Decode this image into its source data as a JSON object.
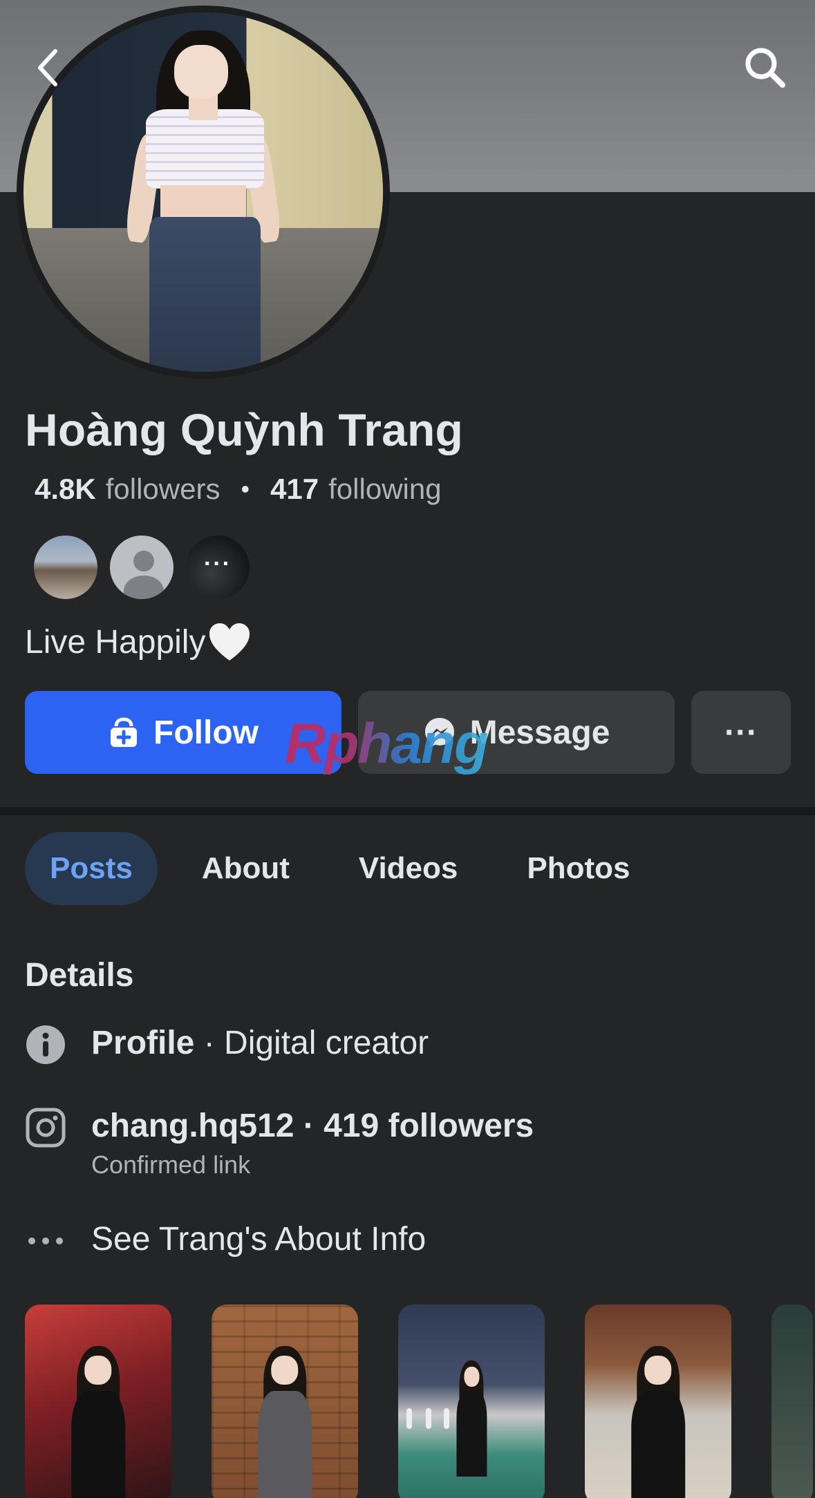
{
  "header": {
    "back_icon": "chevron-left-icon",
    "search_icon": "search-icon"
  },
  "profile": {
    "name": "Hoàng Quỳnh Trang",
    "followers_count": "4.8K",
    "followers_label": "followers",
    "separator": "•",
    "following_count": "417",
    "following_label": "following",
    "mutual_more": "···",
    "bio": "Live Happily",
    "bio_emoji": "white-heart-icon"
  },
  "actions": {
    "follow_label": "Follow",
    "message_label": "Message",
    "more_label": "···"
  },
  "watermark": "Rphang",
  "tabs": [
    {
      "label": "Posts",
      "active": true
    },
    {
      "label": "About",
      "active": false
    },
    {
      "label": "Videos",
      "active": false
    },
    {
      "label": "Photos",
      "active": false
    }
  ],
  "details": {
    "title": "Details",
    "profile_label": "Profile",
    "profile_value": " · Digital creator",
    "instagram_text": "chang.hq512 · 419 followers",
    "instagram_sub": "Confirmed link",
    "about_link": "See Trang's About Info"
  },
  "colors": {
    "background": "#242526",
    "follow_button": "#2d63f3",
    "secondary_button": "#3a3b3c",
    "active_tab_bg": "#263951",
    "active_tab_text": "#6ea2f7",
    "muted_text": "#b0b3b8"
  }
}
